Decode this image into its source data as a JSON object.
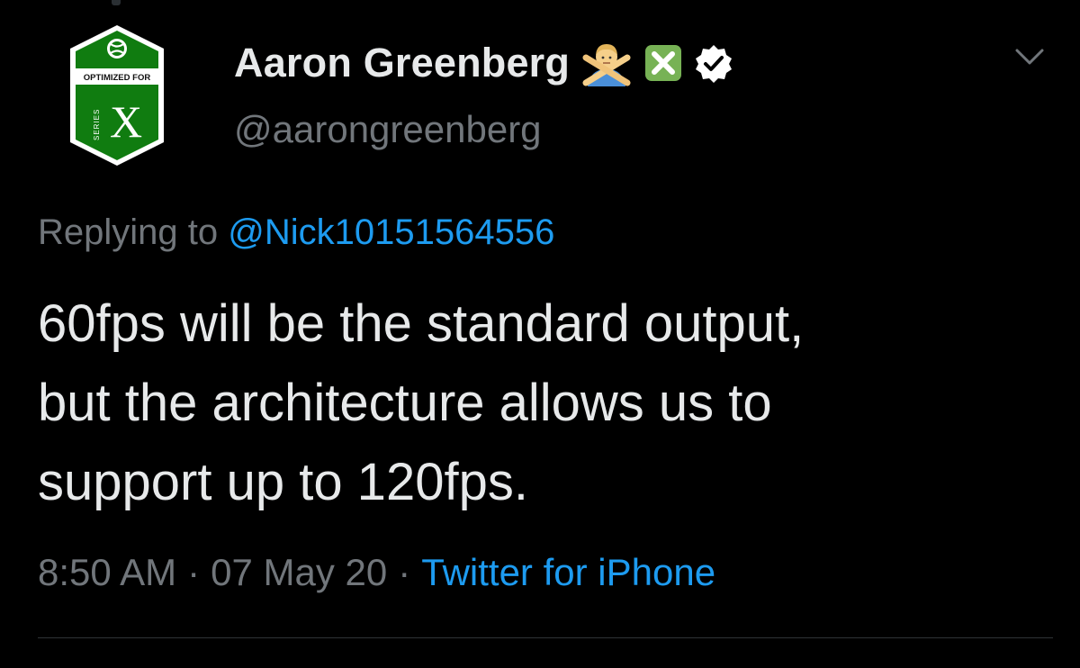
{
  "author": {
    "display_name": "Aaron Greenberg",
    "handle": "@aarongreenberg",
    "verified": true,
    "name_emojis": [
      "person-gesturing-no-icon",
      "cross-mark-button-icon"
    ],
    "avatar": {
      "badge_top_text": "OPTIMIZED FOR",
      "badge_side_text": "SERIES",
      "badge_letter": "X",
      "brand_color": "#107c10"
    }
  },
  "reply": {
    "prefix": "Replying to",
    "target": "@Nick10151564556"
  },
  "tweet": {
    "lines": [
      "60fps will be the standard output,",
      "but the architecture allows us to",
      "support up to 120fps."
    ]
  },
  "meta": {
    "time": "8:50 AM",
    "date": "07 May 20",
    "separator": "·",
    "source": "Twitter for iPhone"
  },
  "colors": {
    "background": "#000000",
    "text": "#e7e9ea",
    "muted": "#71767b",
    "link": "#1d9bf0",
    "divider": "#2f3336"
  }
}
